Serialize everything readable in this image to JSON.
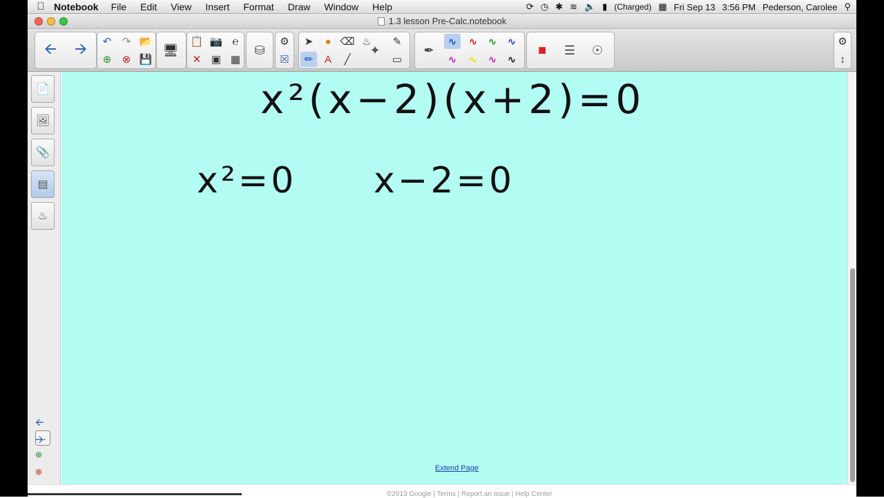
{
  "menubar": {
    "app_name": "Notebook",
    "items": [
      "File",
      "Edit",
      "View",
      "Insert",
      "Format",
      "Draw",
      "Window",
      "Help"
    ],
    "battery_status": "(Charged)",
    "date": "Fri Sep 13",
    "time": "3:56 PM",
    "user": "Pederson, Carolee"
  },
  "window": {
    "title": "1.3 lesson Pre-Calc.notebook"
  },
  "canvas": {
    "equation_main": "x²(x−2)(x+2)=0",
    "equation_left": "x²=0",
    "equation_right": "x−2=0",
    "extend_link": "Extend Page",
    "background_color": "#b2fcf4"
  },
  "footer": {
    "text": "©2013 Google | Terms | Report an issue | Help Center"
  },
  "colors": {
    "pen_blue": "#1a4fd0",
    "pen_red": "#e02020",
    "pen_green": "#20a020",
    "pen_yellow": "#e8e020",
    "pen_magenta": "#d020d0",
    "pen_black": "#222222"
  },
  "icons": {
    "back": "arrow-left-icon",
    "forward": "arrow-right-icon",
    "undo": "undo-icon",
    "redo": "redo-icon",
    "settings": "gear-icon"
  }
}
